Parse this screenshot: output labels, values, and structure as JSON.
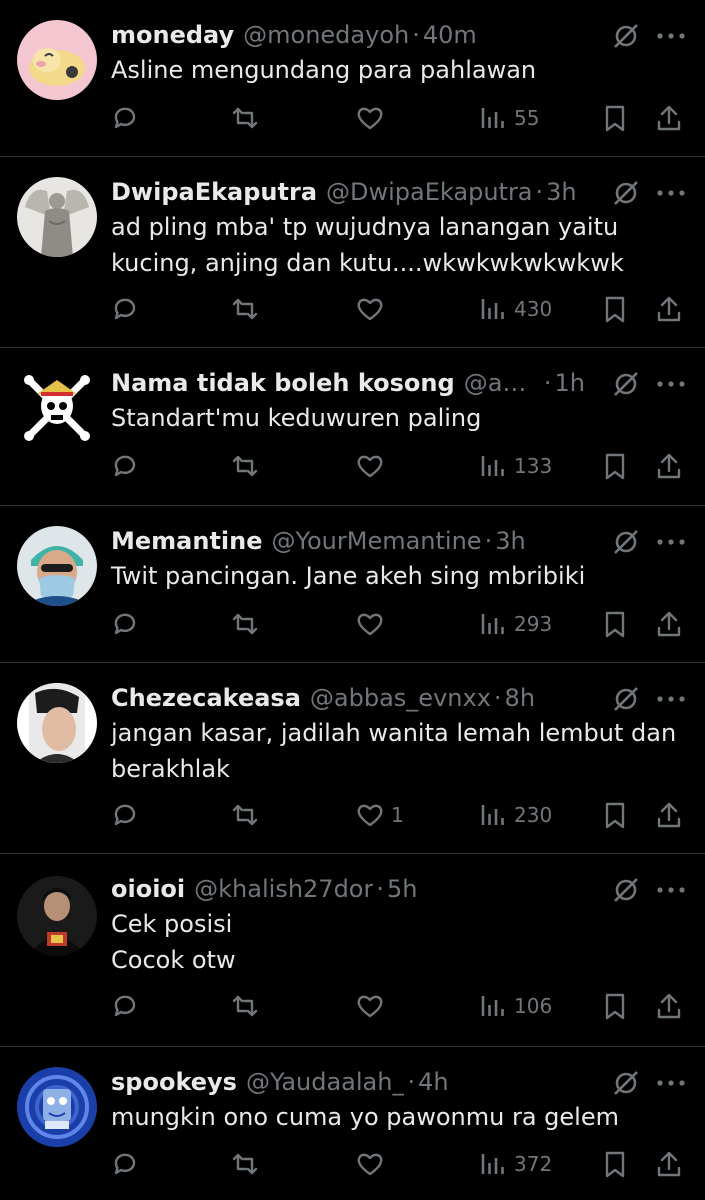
{
  "tweets": [
    {
      "name": "moneday",
      "handle": "@monedayoh",
      "time": "40m",
      "text": "Asline mengundang para pahlawan",
      "likes": "",
      "views": "55",
      "avatar": "pink-plush-avatar"
    },
    {
      "name": "DwipaEkaputra",
      "handle": "@DwipaEkaputra",
      "time": "3h",
      "text": "ad pling mba' tp wujudnya lanangan yaitu kucing, anjing dan kutu....wkwkwkwkwkwk",
      "likes": "",
      "views": "430",
      "avatar": "angel-statue-avatar"
    },
    {
      "name": "Nama tidak boleh kosong",
      "handle": "@andri...",
      "time": "1h",
      "text": "Standart'mu keduwuren paling",
      "likes": "",
      "views": "133",
      "avatar": "straw-hat-jolly-roger-avatar"
    },
    {
      "name": "Memantine",
      "handle": "@YourMemantine",
      "time": "3h",
      "text": "Twit pancingan. Jane akeh sing mbribiki",
      "likes": "",
      "views": "293",
      "avatar": "surgeon-avatar"
    },
    {
      "name": "Chezecakeasa",
      "handle": "@abbas_evnxx",
      "time": "8h",
      "text": "jangan kasar, jadilah wanita lemah lembut dan berakhlak",
      "likes": "1",
      "views": "230",
      "avatar": "person-photo-avatar"
    },
    {
      "name": "oioioi",
      "handle": "@khalish27dor",
      "time": "5h",
      "text": "Cek posisi\nCocok otw",
      "likes": "",
      "views": "106",
      "avatar": "dark-photo-avatar"
    },
    {
      "name": "spookeys",
      "handle": "@Yaudaalah_",
      "time": "4h",
      "text": "mungkin ono cuma yo pawonmu ra gelem",
      "likes": "",
      "views": "372",
      "avatar": "spongebob-avatar"
    }
  ],
  "separator": "·",
  "icons": {
    "mute": "mute-icon",
    "more": "more-icon",
    "reply": "reply-icon",
    "retweet": "retweet-icon",
    "like": "heart-icon",
    "views": "views-icon",
    "bookmark": "bookmark-icon",
    "share": "share-icon"
  },
  "colors": {
    "background": "#000000",
    "text": "#e7e9ea",
    "secondary": "#71767b",
    "divider": "#2f3336"
  }
}
